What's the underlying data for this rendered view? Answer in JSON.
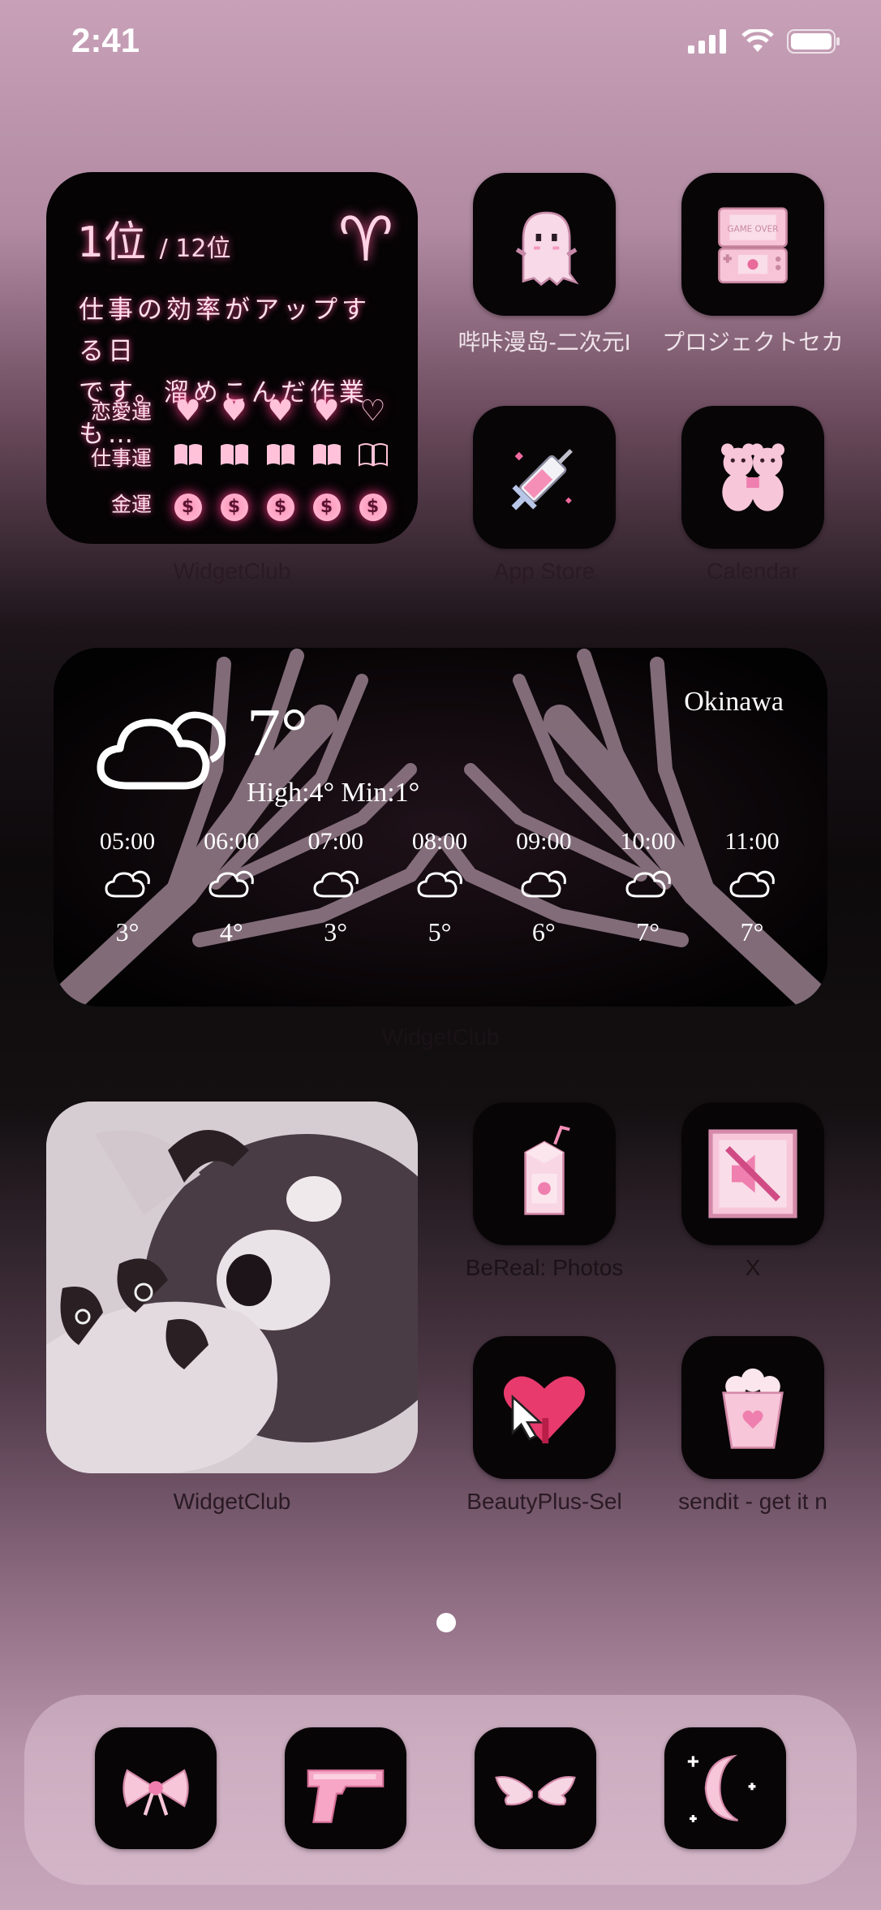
{
  "status_bar": {
    "time": "2:41"
  },
  "horoscope_widget": {
    "rank": "1位",
    "rank_total": "/ 12位",
    "sign_symbol": "♈",
    "message_line1": "仕事の効率がアップする日",
    "message_line2": "です。溜めこんだ作業も…",
    "rows": [
      {
        "label": "恋愛運",
        "filled": 4,
        "total": 5
      },
      {
        "label": "仕事運",
        "filled": 4,
        "total": 5
      },
      {
        "label": "金運",
        "filled": 5,
        "total": 5
      }
    ],
    "caption": "WidgetClub"
  },
  "apps_row1": [
    {
      "label": "哔咔漫岛-二次元I",
      "icon": "ghost-icon"
    },
    {
      "label": "プロジェクトセカ",
      "icon": "game-console-icon"
    }
  ],
  "apps_row2": [
    {
      "label": "App Store",
      "icon": "syringe-icon"
    },
    {
      "label": "Calendar",
      "icon": "teddy-bears-icon"
    }
  ],
  "weather_widget": {
    "city": "Okinawa",
    "temperature": "7°",
    "high_low": "High:4° Min:1°",
    "hourly": [
      {
        "time": "05:00",
        "temp": "3°"
      },
      {
        "time": "06:00",
        "temp": "4°"
      },
      {
        "time": "07:00",
        "temp": "3°"
      },
      {
        "time": "08:00",
        "temp": "5°"
      },
      {
        "time": "09:00",
        "temp": "6°"
      },
      {
        "time": "10:00",
        "temp": "7°"
      },
      {
        "time": "11:00",
        "temp": "7°"
      }
    ],
    "caption": "WidgetClub"
  },
  "photo_widget": {
    "caption": "WidgetClub"
  },
  "apps_row3": [
    {
      "label": "BeReal: Photos",
      "icon": "milk-carton-icon"
    },
    {
      "label": "X",
      "icon": "mute-speaker-icon"
    }
  ],
  "apps_row4": [
    {
      "label": "BeautyPlus-Sel",
      "icon": "heart-cursor-icon"
    },
    {
      "label": "sendit - get it n",
      "icon": "popcorn-box-icon"
    }
  ],
  "dock": [
    {
      "icon": "bow-icon"
    },
    {
      "icon": "pistol-icon"
    },
    {
      "icon": "wings-icon"
    },
    {
      "icon": "moon-stars-icon"
    }
  ],
  "colors": {
    "accent_pink": "#ffb6cf",
    "glow": "#ff3d86"
  }
}
